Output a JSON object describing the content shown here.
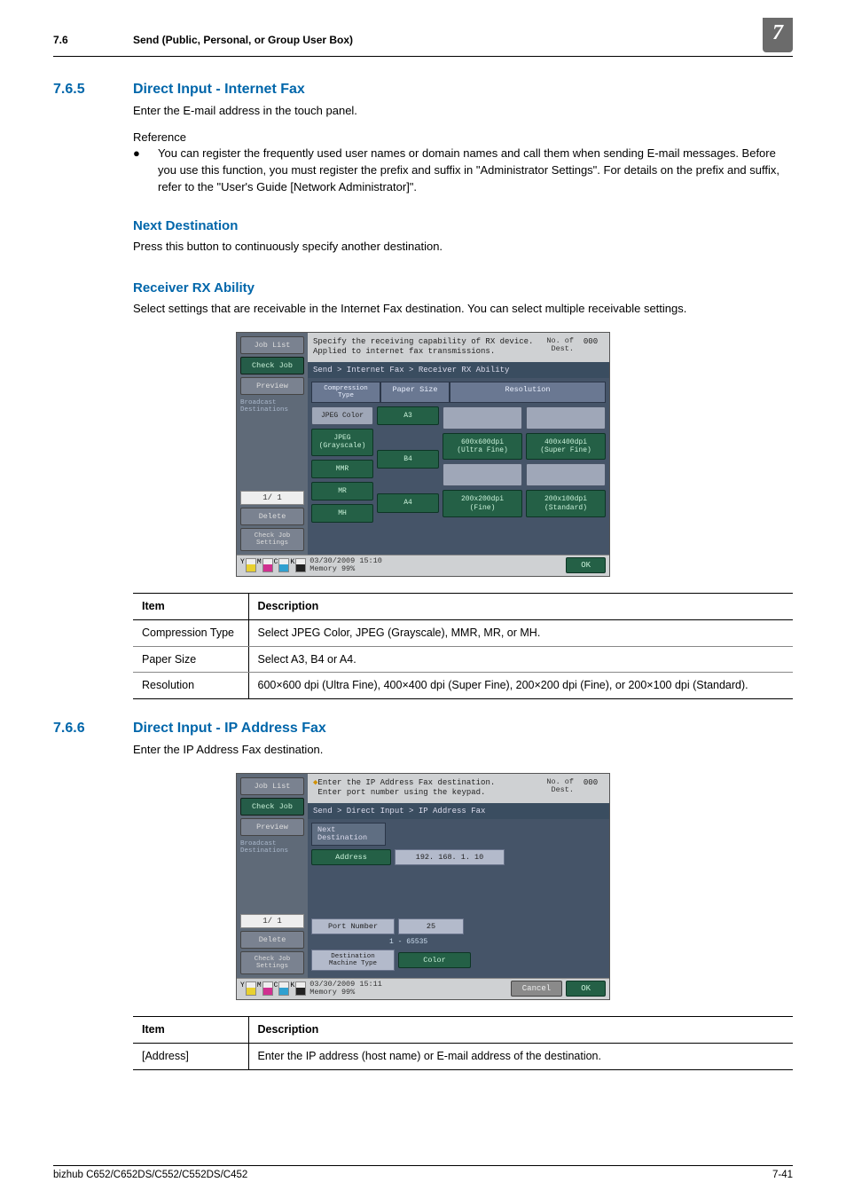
{
  "header": {
    "section_no": "7.6",
    "section_title": "Send (Public, Personal, or Group User Box)",
    "chapter_badge": "7"
  },
  "s765": {
    "num": "7.6.5",
    "title": "Direct Input - Internet Fax",
    "para1": "Enter the E-mail address in the touch panel.",
    "ref_label": "Reference",
    "bullet1": "You can register the frequently used user names or domain names and call them when sending E-mail messages. Before you use this function, you must register the prefix and suffix in \"Administrator Settings\". For details on the prefix and suffix, refer to the \"User's Guide [Network Administrator]\".",
    "sub_nd": "Next Destination",
    "nd_para": "Press this button to continuously specify another destination.",
    "sub_rx": "Receiver RX Ability",
    "rx_para": "Select settings that are receivable in the Internet Fax destination. You can select multiple receivable settings."
  },
  "ss1": {
    "side": {
      "job_list": "Job List",
      "check_job": "Check Job",
      "preview": "Preview",
      "broadcast": "Broadcast\nDestinations",
      "page": "1/  1",
      "delete": "Delete",
      "check_set": "Check Job\nSettings"
    },
    "prompt": "Specify the receiving capability of RX device.\nApplied to internet fax transmissions.",
    "nodest_label": "No. of\nDest.",
    "nodest_val": "000",
    "breadcrumb": "Send > Internet Fax > Receiver RX Ability",
    "hdr": {
      "c1": "Compression\nType",
      "c2": "Paper Size",
      "c3": "Resolution"
    },
    "col1": [
      "JPEG Color",
      "JPEG\n(Grayscale)",
      "MMR",
      "MR",
      "MH"
    ],
    "col2": [
      "A3",
      "",
      "B4",
      "",
      "A4"
    ],
    "col3": [
      "",
      "600x600dpi\n(Ultra Fine)",
      "",
      "200x200dpi\n(Fine)"
    ],
    "col4": [
      "",
      "400x400dpi\n(Super Fine)",
      "",
      "200x100dpi\n(Standard)"
    ],
    "datetime": "03/30/2009   15:10",
    "mem": "Memory      99%",
    "ok": "OK"
  },
  "table1": {
    "h1": "Item",
    "h2": "Description",
    "rows": [
      {
        "item": "Compression Type",
        "desc": "Select JPEG Color, JPEG (Grayscale), MMR, MR, or MH."
      },
      {
        "item": "Paper Size",
        "desc": "Select A3, B4 or A4."
      },
      {
        "item": "Resolution",
        "desc": "600×600 dpi (Ultra Fine), 400×400 dpi (Super Fine), 200×200 dpi (Fine), or 200×100 dpi (Standard)."
      }
    ]
  },
  "s766": {
    "num": "7.6.6",
    "title": "Direct Input - IP Address Fax",
    "para1": "Enter the IP Address Fax destination."
  },
  "ss2": {
    "prompt": "Enter the IP Address Fax destination.\nEnter port number using the keypad.",
    "breadcrumb": "Send > Direct Input > IP Address Fax",
    "next_dest": "Next\nDestination",
    "address_label": "Address",
    "address_val": "192. 168. 1. 10",
    "port_label": "Port Number",
    "port_val": "25",
    "port_range": "1   -   65535",
    "machine_label": "Destination\nMachine Type",
    "machine_val": "Color",
    "datetime": "03/30/2009   15:11",
    "mem": "Memory      99%",
    "cancel": "Cancel",
    "ok": "OK"
  },
  "table2": {
    "h1": "Item",
    "h2": "Description",
    "rows": [
      {
        "item": "[Address]",
        "desc": "Enter the IP address (host name) or E-mail address of the destination."
      }
    ]
  },
  "footer": {
    "model": "bizhub C652/C652DS/C552/C552DS/C452",
    "page": "7-41"
  }
}
